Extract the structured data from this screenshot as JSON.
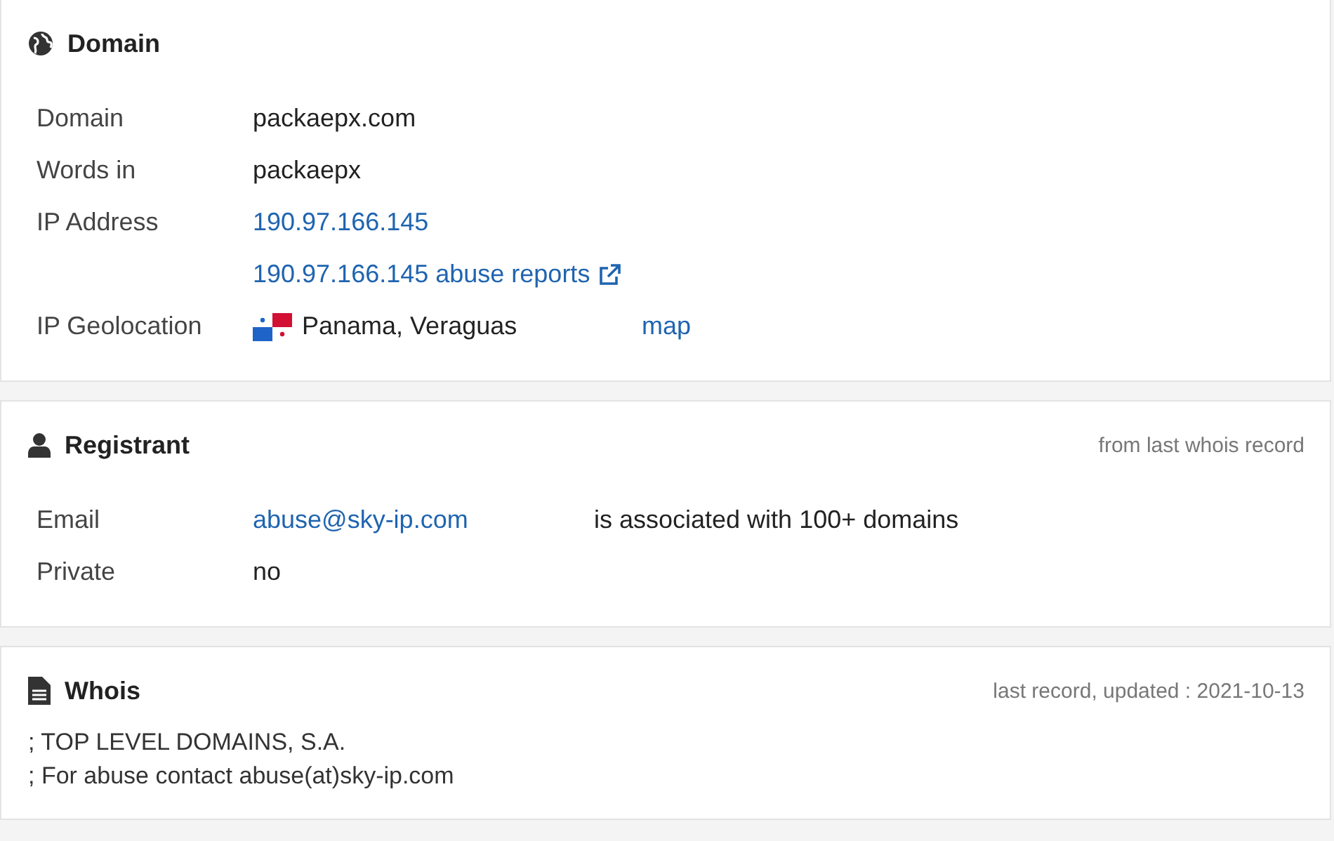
{
  "sections": [
    {
      "kind": "domain",
      "title": "Domain",
      "rows": [
        {
          "label": "Domain",
          "cells": [
            {
              "kind": "text",
              "text": "packaepx.com"
            }
          ]
        },
        {
          "label": "Words in",
          "cells": [
            {
              "kind": "text",
              "text": "packaepx"
            }
          ]
        },
        {
          "label": "IP Address",
          "cells": [
            {
              "kind": "link",
              "text": "190.97.166.145"
            }
          ]
        },
        {
          "cells": [
            {
              "kind": "external-link",
              "text": "190.97.166.145 abuse reports"
            }
          ]
        },
        {
          "label": "IP Geolocation",
          "cells": [
            {
              "kind": "flag-text",
              "text": "Panama, Veraguas"
            },
            {
              "kind": "link",
              "text": "map"
            }
          ]
        }
      ]
    },
    {
      "kind": "registrant",
      "title": "Registrant",
      "note": "from last whois record",
      "rows": [
        {
          "label": "Email",
          "cells": [
            {
              "kind": "link",
              "text": "abuse@sky-ip.com"
            },
            {
              "kind": "text",
              "text": "is associated with 100+ domains"
            }
          ]
        },
        {
          "label": "Private",
          "cells": [
            {
              "kind": "text",
              "text": "no"
            }
          ]
        }
      ]
    },
    {
      "kind": "whois",
      "title": "Whois",
      "note": "last record, updated : 2021-10-13",
      "lines": [
        "; TOP LEVEL DOMAINS, S.A.",
        "; For abuse contact abuse(at)sky-ip.com"
      ]
    }
  ]
}
